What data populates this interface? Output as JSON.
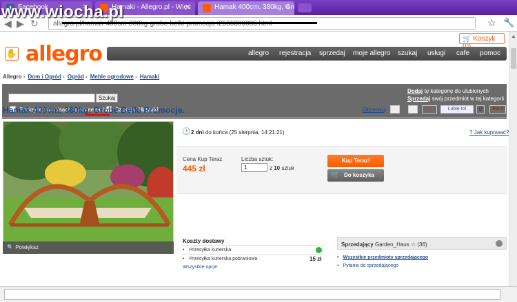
{
  "browser": {
    "tabs": [
      {
        "label": "Facebook",
        "icon": "facebook-icon"
      },
      {
        "label": "Hamaki - Allegro.pl - Więc",
        "icon": "allegro-icon"
      },
      {
        "label": "Hamak 400cm, 380kg, Grób",
        "icon": "allegro-icon"
      }
    ],
    "watermark": "www.wiocha.pl",
    "url": "allegro.pl/hamak-400cm-380kg-grobe-belki-promocja-i2555300085.html",
    "accent": "#6b2bb3"
  },
  "header": {
    "cart_label": "Koszyk (0)",
    "logo_text": "allegro",
    "nav": [
      "allegro",
      "rejestracja",
      "sprzedaj",
      "moje allegro",
      "szukaj",
      "usługi",
      "cafe",
      "pomoc"
    ]
  },
  "breadcrumb": {
    "prefix": "Allegro",
    "items": [
      "Dom i Ogród",
      "Ogród",
      "Meble ogrodowe",
      "Hamaki"
    ]
  },
  "search": {
    "input_value": "",
    "button": "Szukaj",
    "opt_descriptions": "Szukaj też w opisach i parametrach",
    "opt_category_prefix": "Szukaj w",
    "opt_category_name": "Hamaki",
    "fav_link": "Dodaj",
    "fav_text": "tę kategorię do ulubionych",
    "sell_link": "Sprzedaj",
    "sell_text": "swój przedmiot w tej kategorii"
  },
  "product": {
    "title": "Hamak 400cm, 380kg, Gróbe Belki Promocja.",
    "observe": "Obserwuj",
    "gplus": "+1",
    "fb_like": "Lubię to!",
    "like_count": "0",
    "pin": "Pin it",
    "zoom": "Powiększ",
    "time_left_bold": "2 dni",
    "time_left_rest": "do końca (25 sierpnia, 14:21:21)",
    "how_to_buy": "Jak kupować?",
    "price_label": "Cena Kup Teraz",
    "price": "445 zł",
    "qty_label": "Liczba sztuk:",
    "qty_value": "1",
    "qty_prefix": "z",
    "qty_max": "10",
    "qty_unit": "sztuk",
    "buy_now": "Kup Teraz!",
    "to_cart": "Do koszyka",
    "price_color": "#ff5a00"
  },
  "shipping": {
    "title": "Koszty dostawy",
    "rows": [
      {
        "name": "Przesyłka kurierska",
        "price": ""
      },
      {
        "name": "Przesyłka kurierska pobraniowa",
        "price": "15 zł"
      }
    ],
    "all_options": "Wszystkie opcje"
  },
  "seller": {
    "label": "Sprzedający",
    "name": "Garden_Haus",
    "rating": "(36)",
    "links": [
      "Wszystkie przedmioty sprzedającego",
      "Pytanie do sprzedającego"
    ]
  }
}
